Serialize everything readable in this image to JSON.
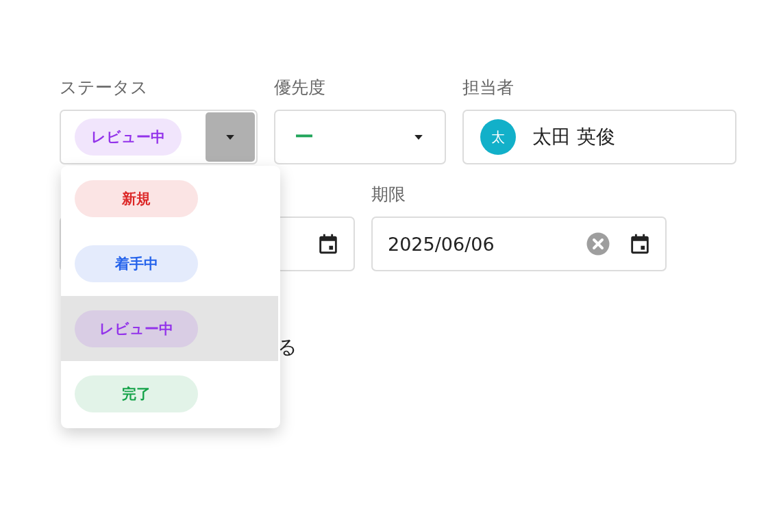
{
  "status": {
    "label": "ステータス",
    "value": "レビュー中",
    "expanded": true,
    "options": [
      {
        "label": "新規",
        "color": "#dc2626",
        "selected": false
      },
      {
        "label": "着手中",
        "color": "#2563eb",
        "selected": false
      },
      {
        "label": "レビュー中",
        "color": "#9333ea",
        "selected": true
      },
      {
        "label": "完了",
        "color": "#16a34a",
        "selected": false
      }
    ]
  },
  "priority": {
    "label": "優先度",
    "value": "ー"
  },
  "assignee": {
    "label": "担当者",
    "avatar": "太",
    "name": "太田 英俊"
  },
  "due": {
    "label": "期限",
    "value": "2025/06/06"
  },
  "checkbox_label": "る"
}
